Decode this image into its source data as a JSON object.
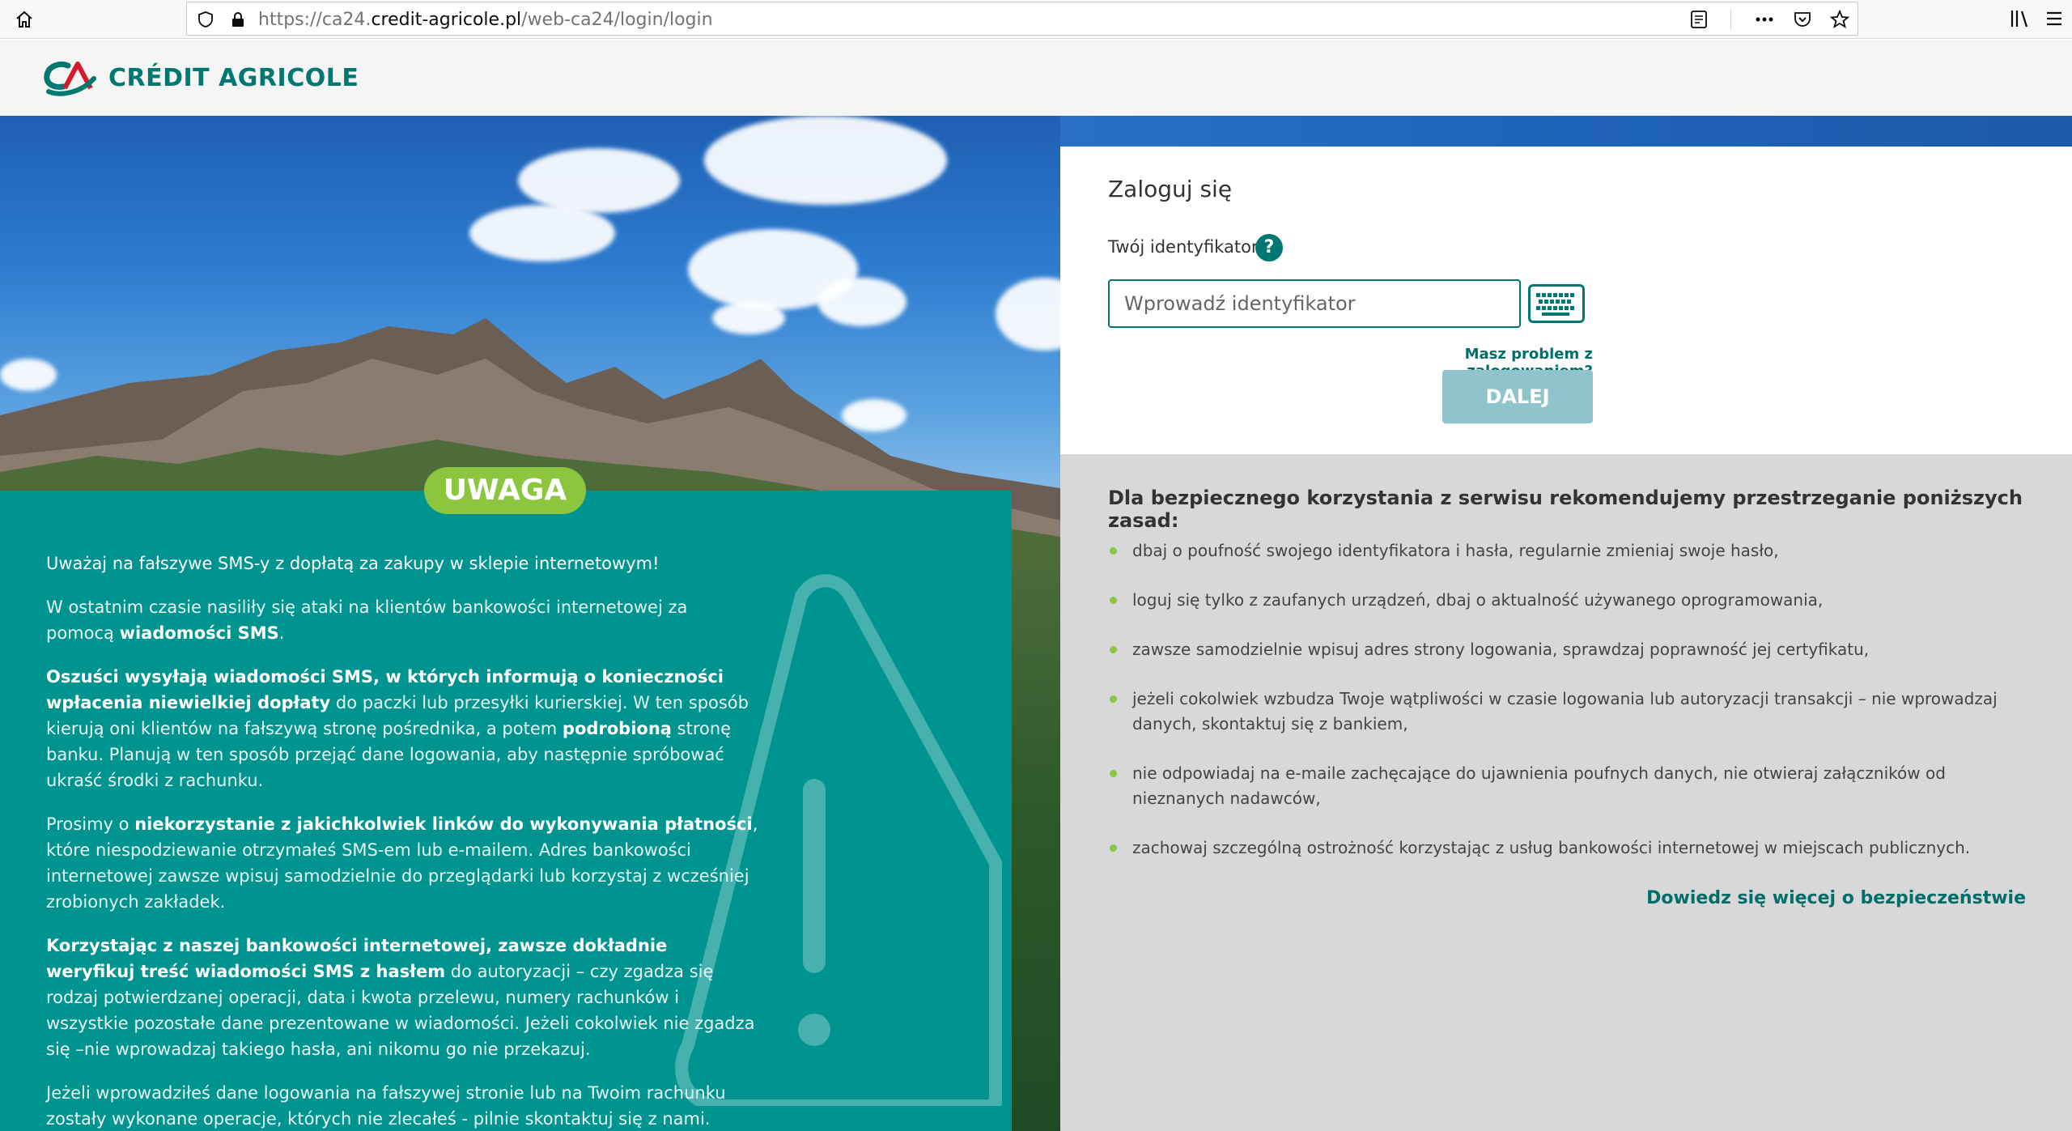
{
  "browser": {
    "url_prefix": "https://ca24.",
    "url_host": "credit-agricole.pl",
    "url_path": "/web-ca24/login/login"
  },
  "header": {
    "logo_text": "CRÉDIT AGRICOLE"
  },
  "warning": {
    "badge": "UWAGA",
    "p1": "Uważaj na fałszywe SMS-y z dopłatą za zakupy w sklepie internetowym!",
    "p2a": "W ostatnim czasie nasiliły się ataki na klientów bankowości internetowej za pomocą ",
    "p2b": "wiadomości SMS",
    "p2c": ".",
    "p3a": "Oszuści wysyłają wiadomości SMS, w których informują o konieczności wpłacenia niewielkiej dopłaty",
    "p3b": " do paczki lub przesyłki kurierskiej. W ten sposób kierują oni klientów na fałszywą stronę pośrednika, a potem ",
    "p3c": "podrobioną",
    "p3d": " stronę banku. Planują w ten sposób przejąć dane logowania, aby następnie spróbować ukraść środki z rachunku.",
    "p4a": "Prosimy o ",
    "p4b": "niekorzystanie z jakichkolwiek linków do wykonywania płatności",
    "p4c": ", które niespodziewanie otrzymałeś SMS-em lub e-mailem. Adres bankowości internetowej zawsze wpisuj samodzielnie do przeglądarki lub korzystaj z wcześniej zrobionych zakładek.",
    "p5a": "Korzystając z naszej bankowości internetowej, zawsze dokładnie weryfikuj treść wiadomości SMS z hasłem",
    "p5b": " do autoryzacji – czy zgadza się rodzaj potwierdzanej operacji, data i kwota przelewu, numery rachunków i wszystkie pozostałe dane prezentowane w wiadomości. Jeżeli cokolwiek nie zgadza się –nie wprowadzaj takiego hasła, ani nikomu go nie przekazuj.",
    "p6": "Jeżeli wprowadziłeś dane logowania na fałszywej stronie lub na Twoim rachunku zostały wykonane operacje, których nie zlecałeś - pilnie skontaktuj się z nami."
  },
  "login": {
    "title": "Zaloguj się",
    "id_label": "Twój identyfikator",
    "help": "?",
    "input_value": "",
    "input_placeholder": "Wprowadź identyfikator",
    "problem_link": "Masz problem z zalogowaniem?",
    "next_button": "DALEJ"
  },
  "tips": {
    "title": "Dla bezpiecznego korzystania z serwisu rekomendujemy przestrzeganie poniższych zasad:",
    "items": [
      "dbaj o poufność swojego identyfikatora i hasła, regularnie zmieniaj swoje hasło,",
      "loguj się tylko z zaufanych urządzeń, dbaj o aktualność używanego oprogramowania,",
      "zawsze samodzielnie wpisuj adres strony logowania, sprawdzaj poprawność jej certyfikatu,",
      "jeżeli cokolwiek wzbudza Twoje wątpliwości w czasie logowania lub autoryzacji transakcji – nie wprowadzaj danych, skontaktuj się z bankiem,",
      "nie odpowiadaj na e-maile zachęcające do ujawnienia poufnych danych, nie otwieraj załączników od nieznanych nadawców,",
      "zachowaj szczególną ostrożność korzystając z usług bankowości internetowej w miejscach publicznych."
    ],
    "more_link": "Dowiedz się więcej o bezpieczeństwie"
  },
  "colors": {
    "brand_teal": "#007770",
    "warning_teal": "#009490",
    "badge_green": "#8cc63f",
    "button_disabled": "#8fc4cc"
  },
  "icons": [
    "home-icon",
    "shield-icon",
    "lock-icon",
    "reader-icon",
    "more-icon",
    "pocket-icon",
    "star-icon",
    "library-icon",
    "menu-icon",
    "help-icon",
    "keyboard-icon",
    "warning-triangle-icon"
  ]
}
